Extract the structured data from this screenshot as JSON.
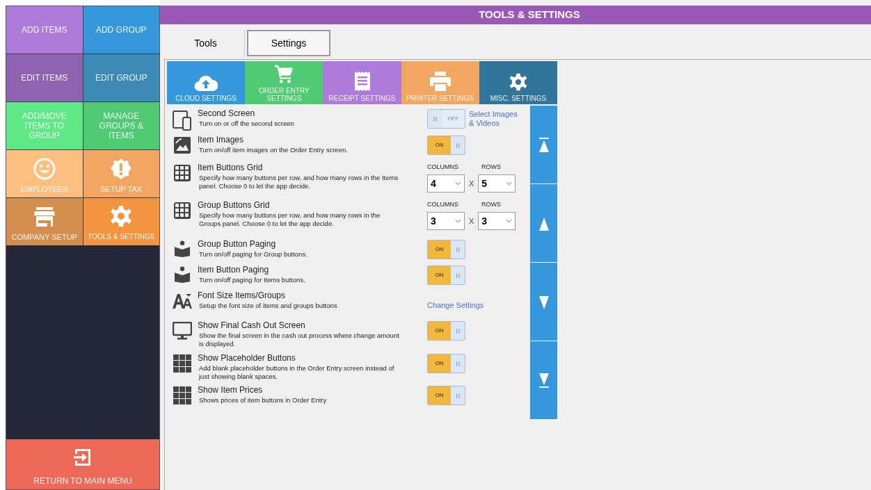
{
  "sidebar": {
    "tiles": [
      {
        "label": "ADD ITEMS",
        "color": "#ad7bda"
      },
      {
        "label": "ADD GROUP",
        "color": "#3598dc"
      },
      {
        "label": "EDIT ITEMS",
        "color": "#8e63b0"
      },
      {
        "label": "EDIT GROUP",
        "color": "#3c8ab5"
      },
      {
        "label": "ADD/MOVE ITEMS TO GROUP",
        "color": "#5fe986"
      },
      {
        "label": "MANAGE GROUPS & ITEMS",
        "color": "#4fcb73"
      },
      {
        "label": "EMPLOYEES",
        "color": "#fdbf80"
      },
      {
        "label": "SETUP TAX",
        "color": "#f3a562"
      },
      {
        "label": "COMPANY SETUP",
        "color": "#d48e4e"
      },
      {
        "label": "TOOLS & SETTINGS",
        "color": "#f29440"
      }
    ],
    "return_button": "RETURN TO MAIN MENU"
  },
  "header": {
    "title": "TOOLS & SETTINGS"
  },
  "tabs": [
    {
      "label": "Tools",
      "selected": false
    },
    {
      "label": "Settings",
      "selected": true
    }
  ],
  "categories": [
    {
      "label": "CLOUD SETTINGS",
      "color": "#3598dc"
    },
    {
      "label": "ORDER ENTRY SETTINGS",
      "color": "#50cb73"
    },
    {
      "label": "RECEIPT SETTINGS",
      "color": "#ad7bda"
    },
    {
      "label": "PRINTER SETTINGS",
      "color": "#f3a562"
    },
    {
      "label": "MISC. SETTINGS",
      "color": "#327599"
    }
  ],
  "settings": [
    {
      "kind": "toggle",
      "title": "Second Screen",
      "description": "Turn on or off the second screen",
      "on": false,
      "toggle_label": "OFF",
      "link": "Select Images & Videos"
    },
    {
      "kind": "toggle",
      "title": "Item Images",
      "description": "Turn on/off item images on the Order Entry screen.",
      "on": true,
      "toggle_label": "ON"
    },
    {
      "kind": "grid",
      "title": "Item Buttons Grid",
      "description": "Specify how many buttons per row, and how many rows in the Items panel.  Choose 0 to let the app decide.",
      "columns_label": "COLUMNS",
      "rows_label": "ROWS",
      "columns": "4",
      "rows": "5",
      "separator": "X"
    },
    {
      "kind": "grid",
      "title": "Group Buttons Grid",
      "description": "Specify how many buttons per row, and how many rows in the Groups panel.  Choose 0 to let the app decide.",
      "columns_label": "COLUMNS",
      "rows_label": "ROWS",
      "columns": "3",
      "rows": "3",
      "separator": "X"
    },
    {
      "kind": "toggle",
      "title": "Group Button Paging",
      "description": "Turn on/off paging for Group buttons.",
      "on": true,
      "toggle_label": "ON"
    },
    {
      "kind": "toggle",
      "title": "Item Button Paging",
      "description": "Turn on/off paging for Items buttons.",
      "on": true,
      "toggle_label": "ON"
    },
    {
      "kind": "link",
      "title": "Font Size Items/Groups",
      "description": "Setup the font size of items and groups buttons",
      "link": "Change Settings"
    },
    {
      "kind": "toggle",
      "title": "Show Final Cash Out Screen",
      "description": "Show the final screen in the cash out process where change amount is displayed.",
      "on": true,
      "toggle_label": "ON"
    },
    {
      "kind": "toggle",
      "title": "Show Placeholder Buttons",
      "description": "Add blank placeholder buttons in the Order Entry screen instead of just showing blank spaces.",
      "on": true,
      "toggle_label": "ON"
    },
    {
      "kind": "toggle",
      "title": "Show Item Prices",
      "description": "Shows prices of item buttons in Order Entry",
      "on": true,
      "toggle_label": "ON"
    }
  ]
}
